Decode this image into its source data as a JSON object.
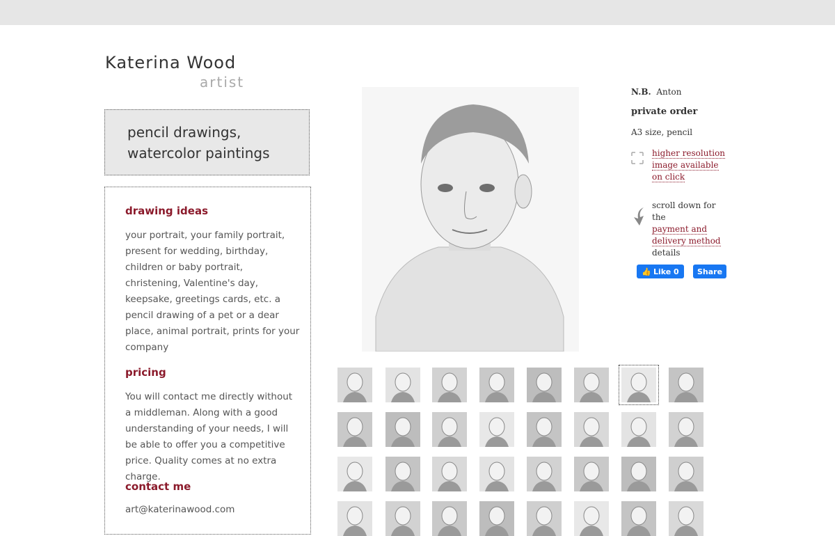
{
  "brand": {
    "name": "Katerina Wood",
    "subtitle": "artist"
  },
  "tagline": {
    "line1": "pencil drawings,",
    "line2": "watercolor paintings"
  },
  "sections": {
    "drawing_ideas": {
      "heading": "drawing ideas",
      "body": "your portrait, your family portrait, present for wedding, birthday, children or baby portrait, christening, Valentine's day, keepsake, greetings cards, etc. a pencil drawing of a pet or a dear place, animal portrait, prints for your company"
    },
    "pricing": {
      "heading": "pricing",
      "body": "You will contact me directly without a middleman. Along with a good understanding of your needs, I will be able to offer you a competitive price. Quality comes at no extra charge."
    },
    "contact": {
      "heading": "contact me",
      "email": "art@katerinawood.com"
    }
  },
  "artwork": {
    "initials": "N.B.",
    "name": "Anton",
    "order_type": "private order",
    "spec": "A3 size, pencil",
    "hires_link": "higher resolution image available on click",
    "scroll_prefix": "scroll down for the",
    "scroll_link": "payment and delivery method",
    "scroll_suffix": "details"
  },
  "social": {
    "like_label": "Like 0",
    "share_label": "Share"
  },
  "colors": {
    "accent": "#8b1a2b",
    "facebook": "#1877f2",
    "band": "#e6e6e6"
  },
  "thumbnails": {
    "selected_index": 6
  }
}
